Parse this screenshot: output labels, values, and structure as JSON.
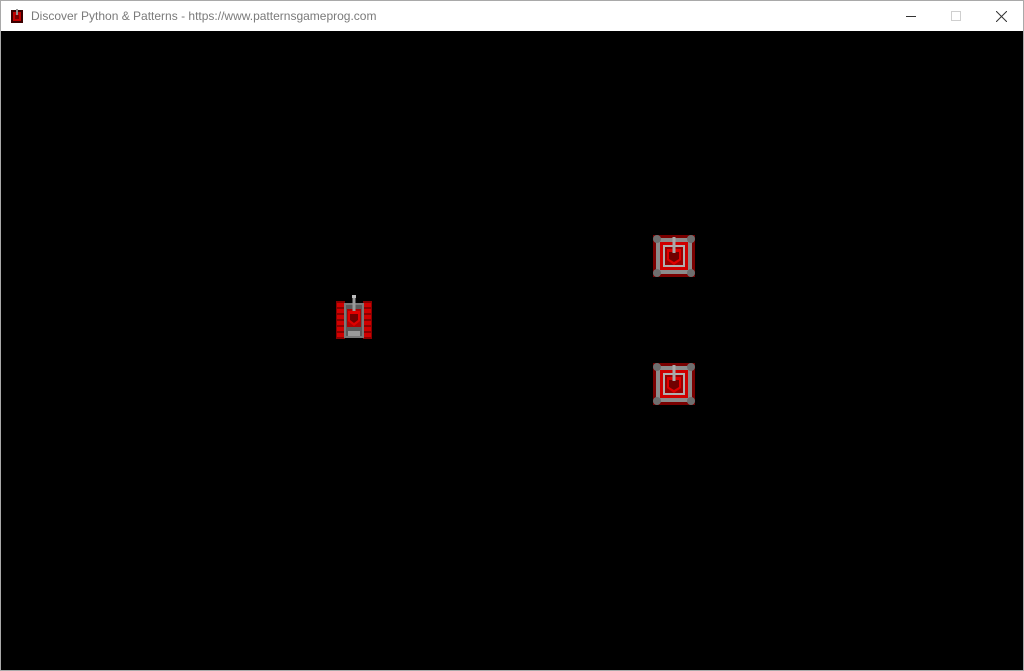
{
  "window": {
    "title": "Discover Python & Patterns - https://www.patternsgameprog.com",
    "app_icon": "tank-app-icon",
    "controls": [
      "minimize-icon",
      "maximize-icon",
      "close-icon"
    ]
  },
  "game": {
    "background_color": "#000000",
    "player_color": "#c00000",
    "turret_gray": "#808080",
    "sprites": [
      {
        "name": "player-tank",
        "icon": "tank-icon"
      },
      {
        "name": "enemy-tower",
        "icon": "tower-icon"
      },
      {
        "name": "enemy-tower",
        "icon": "tower-icon"
      }
    ]
  }
}
